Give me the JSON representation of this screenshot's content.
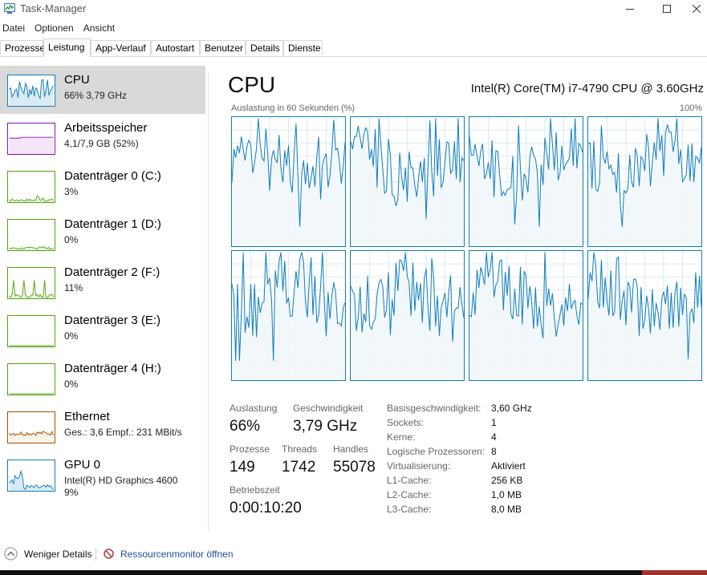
{
  "window": {
    "title": "Task-Manager"
  },
  "menu": [
    "Datei",
    "Optionen",
    "Ansicht"
  ],
  "tabs": [
    {
      "label": "Prozesse"
    },
    {
      "label": "Leistung"
    },
    {
      "label": "App-Verlauf"
    },
    {
      "label": "Autostart"
    },
    {
      "label": "Benutzer"
    },
    {
      "label": "Details"
    },
    {
      "label": "Dienste"
    }
  ],
  "active_tab": "Leistung",
  "sidebar": [
    {
      "name": "CPU",
      "sub": "66% 3,79 GHz",
      "color": "#117dbb",
      "fill": "#d9eaf4",
      "selected": true
    },
    {
      "name": "Arbeitsspeicher",
      "sub": "4,1/7,9 GB (52%)",
      "color": "#8b12ae",
      "fill": "#f4e6f8"
    },
    {
      "name": "Datenträger 0 (C:)",
      "sub": "3%",
      "color": "#4da60c",
      "fill": "#eff7e9"
    },
    {
      "name": "Datenträger 1 (D:)",
      "sub": "0%",
      "color": "#4da60c",
      "fill": "#eff7e9"
    },
    {
      "name": "Datenträger 2 (F:)",
      "sub": "11%",
      "color": "#4da60c",
      "fill": "#eff7e9"
    },
    {
      "name": "Datenträger 3 (E:)",
      "sub": "0%",
      "color": "#4da60c",
      "fill": "#eff7e9"
    },
    {
      "name": "Datenträger 4 (H:)",
      "sub": "0%",
      "color": "#4da60c",
      "fill": "#eff7e9"
    },
    {
      "name": "Ethernet",
      "sub": "Ges.: 3,6 Empf.: 231 MBit/s",
      "color": "#a74f01",
      "fill": "#fcf3eb"
    },
    {
      "name": "GPU 0",
      "sub": "Intel(R) HD Graphics 4600\n9%",
      "color": "#117dbb",
      "fill": "#d9eaf4"
    }
  ],
  "main": {
    "title": "CPU",
    "model": "Intel(R) Core(TM) i7-4790 CPU @ 3.60GHz",
    "graph_label": "Auslastung in 60 Sekunden (%)",
    "graph_max": "100%",
    "accent": "#117dbb",
    "graph_fill": "#f1f6fa"
  },
  "stats": {
    "utilization_label": "Auslastung",
    "utilization": "66%",
    "speed_label": "Geschwindigkeit",
    "speed": "3,79 GHz",
    "processes_label": "Prozesse",
    "processes": "149",
    "threads_label": "Threads",
    "threads": "1742",
    "handles_label": "Handles",
    "handles": "55078",
    "uptime_label": "Betriebszeit",
    "uptime": "0:00:10:20"
  },
  "details": [
    {
      "label": "Basisgeschwindigkeit:",
      "value": "3,60 GHz"
    },
    {
      "label": "Sockets:",
      "value": "1"
    },
    {
      "label": "Kerne:",
      "value": "4"
    },
    {
      "label": "Logische Prozessoren:",
      "value": "8"
    },
    {
      "label": "Virtualisierung:",
      "value": "Aktiviert"
    },
    {
      "label": "L1-Cache:",
      "value": "256 KB"
    },
    {
      "label": "L2-Cache:",
      "value": "1,0 MB"
    },
    {
      "label": "L3-Cache:",
      "value": "8,0 MB"
    }
  ],
  "footer": {
    "fewer_details": "Weniger Details",
    "resource_monitor": "Ressourcenmonitor öffnen",
    "link_color": "#1e4d9b"
  }
}
